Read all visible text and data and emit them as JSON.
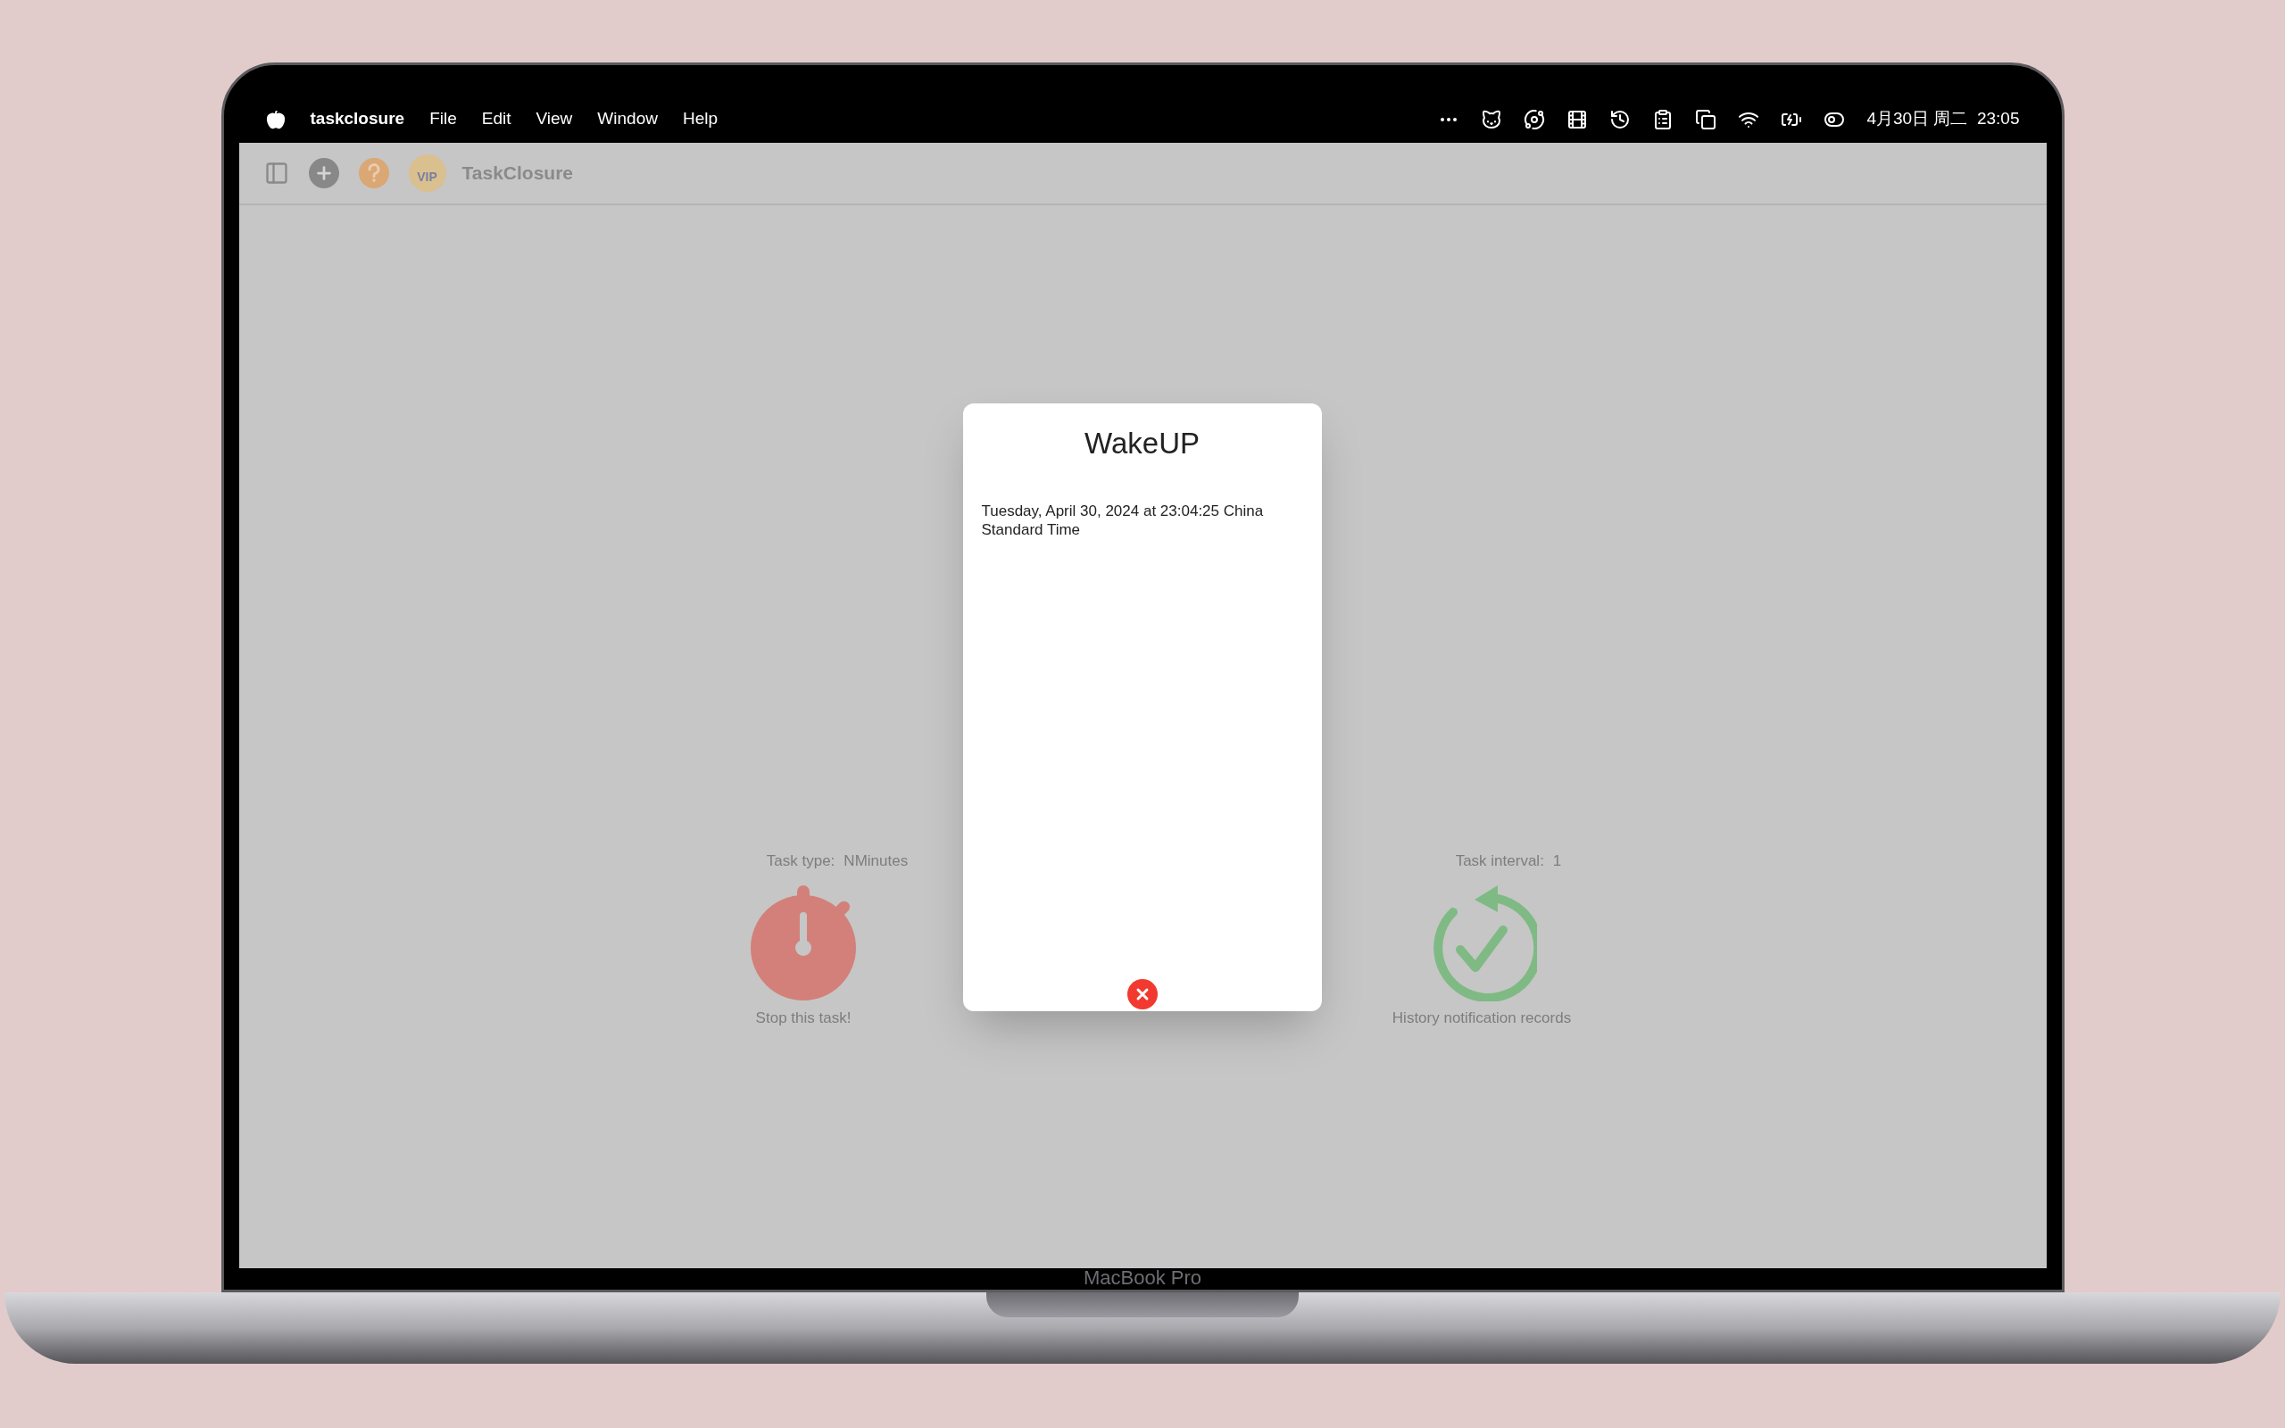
{
  "menu_bar": {
    "app_name": "taskclosure",
    "menus": [
      "File",
      "Edit",
      "View",
      "Window",
      "Help"
    ],
    "clock": "4月30日 周二  23:05"
  },
  "toolbar": {
    "vip_badge": "VIP",
    "title": "TaskClosure"
  },
  "task": {
    "type_label": "Task type:",
    "type_value": "NMinutes",
    "interval_label": "Task interval:",
    "interval_value": "1",
    "stop_label": "Stop this task!",
    "history_label": "History notification records"
  },
  "dialog": {
    "title": "WakeUP",
    "message": "Tuesday, April 30, 2024 at 23:04:25 China Standard Time"
  },
  "device_label": "MacBook Pro"
}
